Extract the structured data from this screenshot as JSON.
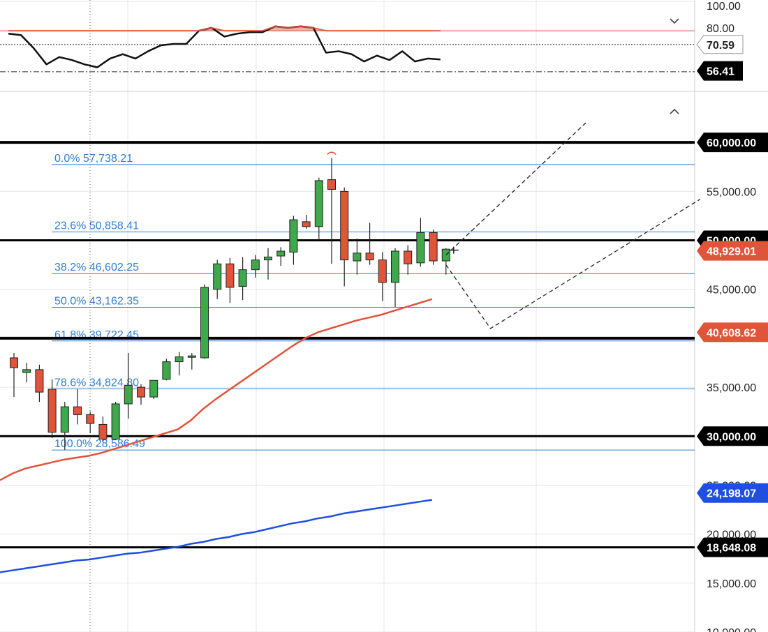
{
  "chart_data": {
    "type": "candlestick",
    "instrument_panel": {
      "type": "line",
      "name": "oscillator",
      "axis_ticks": [
        "100.00",
        "80.00"
      ],
      "overbought_level": 80,
      "reference_value": 70.59,
      "lower_level": 52,
      "current_value": 56.41,
      "values": [
        78,
        77,
        68,
        57,
        62,
        60,
        57,
        55,
        61,
        64,
        61,
        66,
        70,
        71,
        71,
        80,
        82,
        76,
        78,
        79,
        79,
        83,
        82,
        83,
        82,
        65,
        66,
        64,
        59,
        63,
        60,
        66,
        59,
        61,
        60.4
      ]
    },
    "price_axis": {
      "ylim": [
        10000,
        65000
      ],
      "tick_labels": [
        "55,000.00",
        "45,000.00",
        "35,000.00",
        "25,000.00",
        "20,000.00",
        "15,000.00",
        "10,000.00"
      ]
    },
    "candles": [
      {
        "o": 38000,
        "h": 38500,
        "l": 34000,
        "c": 37000
      },
      {
        "o": 36500,
        "h": 37500,
        "l": 35500,
        "c": 36800
      },
      {
        "o": 36800,
        "h": 37300,
        "l": 33500,
        "c": 34500
      },
      {
        "o": 34800,
        "h": 35800,
        "l": 29800,
        "c": 30400
      },
      {
        "o": 30400,
        "h": 33500,
        "l": 28600,
        "c": 33000
      },
      {
        "o": 33000,
        "h": 34800,
        "l": 31200,
        "c": 32200
      },
      {
        "o": 32200,
        "h": 32500,
        "l": 30300,
        "c": 31300
      },
      {
        "o": 31200,
        "h": 32000,
        "l": 29400,
        "c": 29700
      },
      {
        "o": 29700,
        "h": 33500,
        "l": 29600,
        "c": 33300
      },
      {
        "o": 33300,
        "h": 38500,
        "l": 31800,
        "c": 35200
      },
      {
        "o": 35000,
        "h": 35300,
        "l": 33200,
        "c": 34000
      },
      {
        "o": 34000,
        "h": 35700,
        "l": 33800,
        "c": 35700
      },
      {
        "o": 35800,
        "h": 37900,
        "l": 35700,
        "c": 37600
      },
      {
        "o": 37600,
        "h": 38600,
        "l": 36200,
        "c": 38100
      },
      {
        "o": 38100,
        "h": 38500,
        "l": 36800,
        "c": 38200
      },
      {
        "o": 38000,
        "h": 45500,
        "l": 37900,
        "c": 45200
      },
      {
        "o": 45000,
        "h": 48000,
        "l": 44000,
        "c": 47600
      },
      {
        "o": 47600,
        "h": 48200,
        "l": 43600,
        "c": 45200
      },
      {
        "o": 45300,
        "h": 48300,
        "l": 43900,
        "c": 47000
      },
      {
        "o": 47000,
        "h": 48500,
        "l": 46200,
        "c": 48000
      },
      {
        "o": 48000,
        "h": 49200,
        "l": 46000,
        "c": 48300
      },
      {
        "o": 48400,
        "h": 49300,
        "l": 47400,
        "c": 48900
      },
      {
        "o": 48800,
        "h": 52500,
        "l": 47500,
        "c": 52100
      },
      {
        "o": 51900,
        "h": 52600,
        "l": 51200,
        "c": 51400
      },
      {
        "o": 51400,
        "h": 56400,
        "l": 50000,
        "c": 56100
      },
      {
        "o": 56200,
        "h": 58400,
        "l": 47600,
        "c": 55200
      },
      {
        "o": 55000,
        "h": 55400,
        "l": 45300,
        "c": 48000
      },
      {
        "o": 47900,
        "h": 50200,
        "l": 46500,
        "c": 48700
      },
      {
        "o": 48700,
        "h": 51800,
        "l": 47500,
        "c": 48000
      },
      {
        "o": 48000,
        "h": 48800,
        "l": 43800,
        "c": 45700
      },
      {
        "o": 45700,
        "h": 49200,
        "l": 43200,
        "c": 48900
      },
      {
        "o": 48900,
        "h": 49500,
        "l": 46500,
        "c": 47600
      },
      {
        "o": 47700,
        "h": 52300,
        "l": 47300,
        "c": 50800
      },
      {
        "o": 50800,
        "h": 51100,
        "l": 47500,
        "c": 47900
      },
      {
        "o": 47900,
        "h": 49200,
        "l": 46500,
        "c": 49100
      }
    ],
    "horizontal_levels": [
      60000,
      50000,
      40000,
      30000,
      18648.08
    ],
    "price_tags": [
      {
        "label": "60,000.00",
        "value": 60000,
        "color": "#000000"
      },
      {
        "label": "50,000.00",
        "value": 50000,
        "color": "#000000"
      },
      {
        "label": "48,929.01",
        "value": 48929.01,
        "color": "#e0543a"
      },
      {
        "label": "40,608.62",
        "value": 40608.62,
        "color": "#e0543a"
      },
      {
        "label": "30,000.00",
        "value": 30000,
        "color": "#000000"
      },
      {
        "label": "24,198.07",
        "value": 24198.07,
        "color": "#1f4fe0"
      },
      {
        "label": "18,648.08",
        "value": 18648.08,
        "color": "#000000"
      }
    ],
    "fibonacci": [
      {
        "label": "0.0% 57,738.21",
        "value": 57738.21
      },
      {
        "label": "23.6% 50,858.41",
        "value": 50858.41
      },
      {
        "label": "38.2% 46,602.25",
        "value": 46602.25
      },
      {
        "label": "50.0% 43,162.35",
        "value": 43162.35
      },
      {
        "label": "61.8% 39,722.45",
        "value": 39722.45
      },
      {
        "label": "78.6% 34,824.80",
        "value": 34824.8
      },
      {
        "label": "100.0% 28,586.49",
        "value": 28586.49
      }
    ],
    "moving_averages": [
      {
        "color": "#e0543a",
        "values": [
          25500,
          26200,
          26700,
          27000,
          27300,
          27600,
          27800,
          28000,
          28300,
          28700,
          29100,
          29500,
          29900,
          30300,
          30700,
          31600,
          32800,
          33800,
          34700,
          35600,
          36500,
          37400,
          38300,
          39200,
          40000,
          40600,
          41000,
          41400,
          41800,
          42100,
          42400,
          42800,
          43200,
          43600,
          44000
        ]
      },
      {
        "color": "#1f4fe0",
        "values": [
          16100,
          16300,
          16500,
          16700,
          16900,
          17100,
          17300,
          17400,
          17600,
          17800,
          18000,
          18100,
          18300,
          18500,
          18700,
          19000,
          19200,
          19500,
          19700,
          20000,
          20200,
          20500,
          20800,
          21100,
          21300,
          21600,
          21800,
          22100,
          22300,
          22500,
          22700,
          22900,
          23100,
          23300,
          23500
        ]
      }
    ],
    "projections": [
      [
        {
          "i": 34,
          "v": 48500
        },
        {
          "i": 45,
          "v": 62000
        }
      ],
      [
        {
          "i": 34,
          "v": 47500
        },
        {
          "i": 37.5,
          "v": 41000
        },
        {
          "i": 54,
          "v": 54200
        }
      ]
    ],
    "grid": true,
    "legend": "none"
  }
}
